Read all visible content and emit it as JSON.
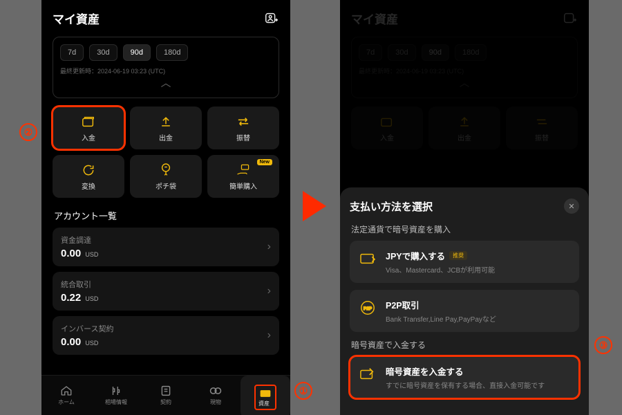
{
  "colors": {
    "accent": "#f0b90b",
    "bg": "#000",
    "panel": "#1a1a1a",
    "danger": "#ff3200"
  },
  "header": {
    "title": "マイ資産",
    "transfer_icon": "account-switch"
  },
  "period": {
    "pills": [
      "7d",
      "30d",
      "90d",
      "180d"
    ],
    "selected": "90d",
    "updated_prefix": "最終更新時：",
    "updated_value": "2024-06-19 03:23 (UTC)"
  },
  "actions": [
    {
      "key": "deposit",
      "label": "入金",
      "icon": "wallet"
    },
    {
      "key": "withdraw",
      "label": "出金",
      "icon": "upload"
    },
    {
      "key": "transfer",
      "label": "振替",
      "icon": "swap"
    },
    {
      "key": "convert",
      "label": "変換",
      "icon": "refresh"
    },
    {
      "key": "pochi",
      "label": "ポチ袋",
      "icon": "balloon"
    },
    {
      "key": "easybuy",
      "label": "簡単購入",
      "icon": "hand-card",
      "badge": "New"
    }
  ],
  "accounts_title": "アカウント一覧",
  "accounts": [
    {
      "name": "資金調達",
      "value": "0.00",
      "ccy": "USD"
    },
    {
      "name": "統合取引",
      "value": "0.22",
      "ccy": "USD"
    },
    {
      "name": "インバース契約",
      "value": "0.00",
      "ccy": "USD"
    }
  ],
  "nav": [
    {
      "key": "home",
      "label": "ホーム"
    },
    {
      "key": "market",
      "label": "相場情報"
    },
    {
      "key": "contract",
      "label": "契約"
    },
    {
      "key": "spot",
      "label": "現物"
    },
    {
      "key": "assets",
      "label": "資産"
    }
  ],
  "nav_active": "assets",
  "sheet": {
    "title": "支払い方法を選択",
    "section_fiat": "法定通貨で暗号資産を購入",
    "section_crypto": "暗号資産で入金する",
    "options": [
      {
        "name": "JPYで購入する",
        "desc": "Visa、Mastercard、JCBが利用可能",
        "badge": "推奨",
        "icon": "card"
      },
      {
        "name": "P2P取引",
        "desc": "Bank Transfer,Line Pay,PayPayなど",
        "icon": "p2p"
      }
    ],
    "crypto_opt": {
      "name": "暗号資産を入金する",
      "desc": "すでに暗号資産を保有する場合、直接入金可能です",
      "icon": "wallet-in"
    }
  },
  "callouts": {
    "c1": "①",
    "c2": "②",
    "c3": "③"
  }
}
